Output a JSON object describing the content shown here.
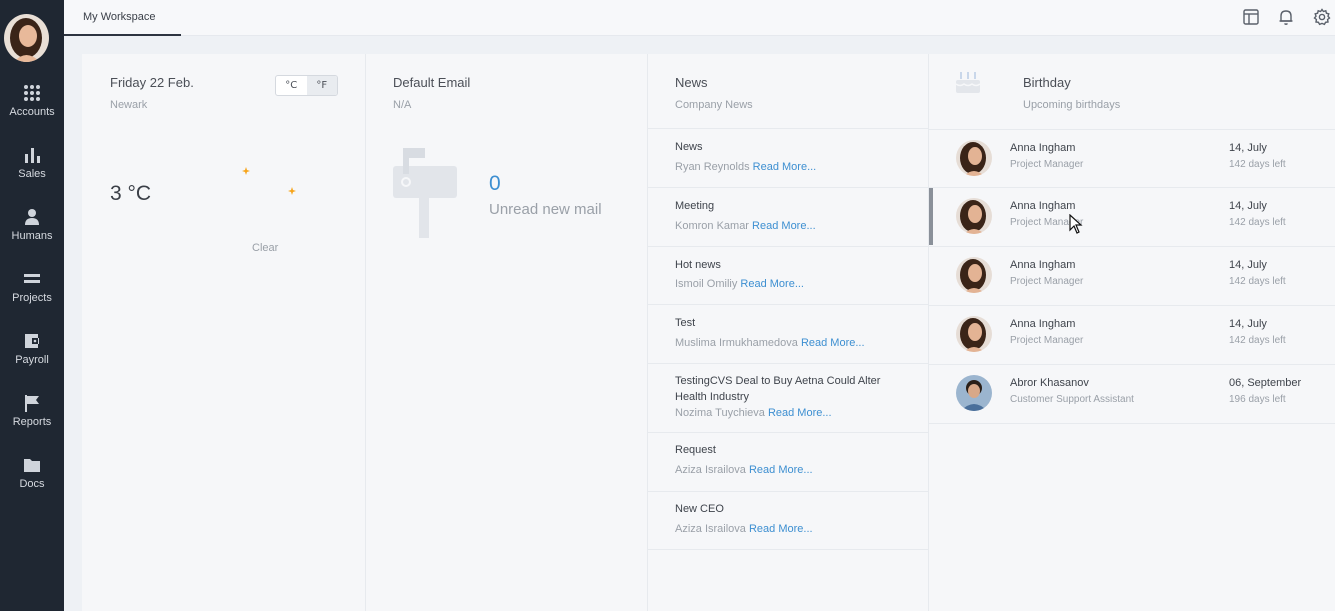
{
  "sidebar": {
    "items": [
      {
        "label": "Accounts",
        "icon": "grid-icon"
      },
      {
        "label": "Sales",
        "icon": "bar-chart-icon"
      },
      {
        "label": "Humans",
        "icon": "person-icon"
      },
      {
        "label": "Projects",
        "icon": "stack-icon"
      },
      {
        "label": "Payroll",
        "icon": "wallet-icon"
      },
      {
        "label": "Reports",
        "icon": "flag-icon"
      },
      {
        "label": "Docs",
        "icon": "folder-icon"
      }
    ]
  },
  "header": {
    "tab": "My Workspace",
    "icons": [
      "layout-icon",
      "bell-icon",
      "gear-icon"
    ]
  },
  "weather": {
    "date": "Friday 22 Feb.",
    "city": "Newark",
    "unit_c": "°C",
    "unit_f": "°F",
    "active_unit": "F",
    "temperature": "3 °C",
    "condition": "Clear",
    "icon": "moon-icon"
  },
  "email": {
    "title": "Default Email",
    "address": "N/A",
    "count": "0",
    "label": "Unread new mail",
    "icon": "mailbox-icon"
  },
  "news": {
    "title": "News",
    "subtitle": "Company News",
    "read_more": "Read More...",
    "items": [
      {
        "title": "News",
        "author": "Ryan Reynolds"
      },
      {
        "title": "Meeting",
        "author": "Komron Kamar"
      },
      {
        "title": "Hot news",
        "author": "Ismoil Omiliy"
      },
      {
        "title": "Test",
        "author": "Muslima Irmukhamedova"
      },
      {
        "title": "TestingCVS Deal to Buy Aetna Could Alter Health Industry",
        "author": "Nozima Tuychieva"
      },
      {
        "title": "Request",
        "author": "Aziza Israilova"
      },
      {
        "title": "New CEO",
        "author": "Aziza Israilova"
      }
    ]
  },
  "birthday": {
    "title": "Birthday",
    "subtitle": "Upcoming birthdays",
    "icon": "cake-icon",
    "items": [
      {
        "name": "Anna Ingham",
        "role": "Project Manager",
        "date": "14, July",
        "left": "142 days left"
      },
      {
        "name": "Anna Ingham",
        "role": "Project Manager",
        "date": "14, July",
        "left": "142 days left"
      },
      {
        "name": "Anna Ingham",
        "role": "Project Manager",
        "date": "14, July",
        "left": "142 days left"
      },
      {
        "name": "Anna Ingham",
        "role": "Project Manager",
        "date": "14, July",
        "left": "142 days left"
      },
      {
        "name": "Abror Khasanov",
        "role": "Customer Support Assistant",
        "date": "06, September",
        "left": "196 days left"
      }
    ]
  },
  "colors": {
    "sidebar_bg": "#1f2732",
    "accent": "#3d8fd1",
    "moon": "#f7a51b"
  }
}
